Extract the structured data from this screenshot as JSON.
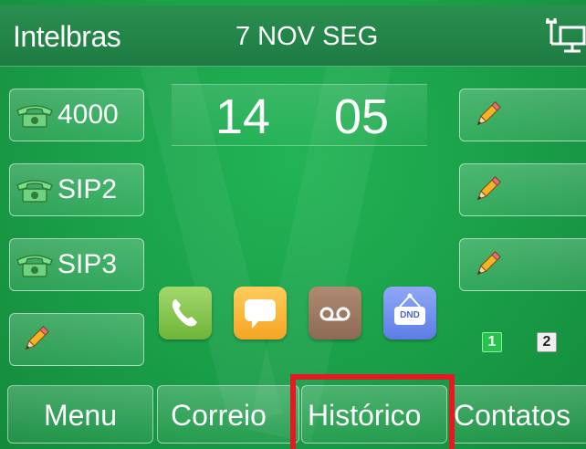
{
  "header": {
    "title": "Intelbras",
    "date": "7 NOV SEG",
    "network_icon": "network-icon"
  },
  "clock": {
    "hours": "14",
    "minutes": "05"
  },
  "left_keys": [
    {
      "label": "4000",
      "icon": "phone-icon"
    },
    {
      "label": "SIP2",
      "icon": "phone-icon"
    },
    {
      "label": "SIP3",
      "icon": "phone-icon"
    },
    {
      "label": "",
      "icon": "pencil-icon"
    }
  ],
  "right_keys": [
    {
      "label": "",
      "icon": "pencil-icon"
    },
    {
      "label": "",
      "icon": "pencil-icon"
    },
    {
      "label": "",
      "icon": "pencil-icon"
    }
  ],
  "apps": [
    {
      "name": "phone-app-icon"
    },
    {
      "name": "message-app-icon"
    },
    {
      "name": "voicemail-app-icon"
    },
    {
      "name": "dnd-app-icon",
      "badge": "DND"
    }
  ],
  "pages": {
    "current": "1",
    "next": "2"
  },
  "softkeys": [
    "Menu",
    "Correio",
    "Histórico",
    "Contatos"
  ],
  "colors": {
    "screen": "#1a9e48",
    "highlight": "#e21b23",
    "active_page": "#27c24c"
  }
}
